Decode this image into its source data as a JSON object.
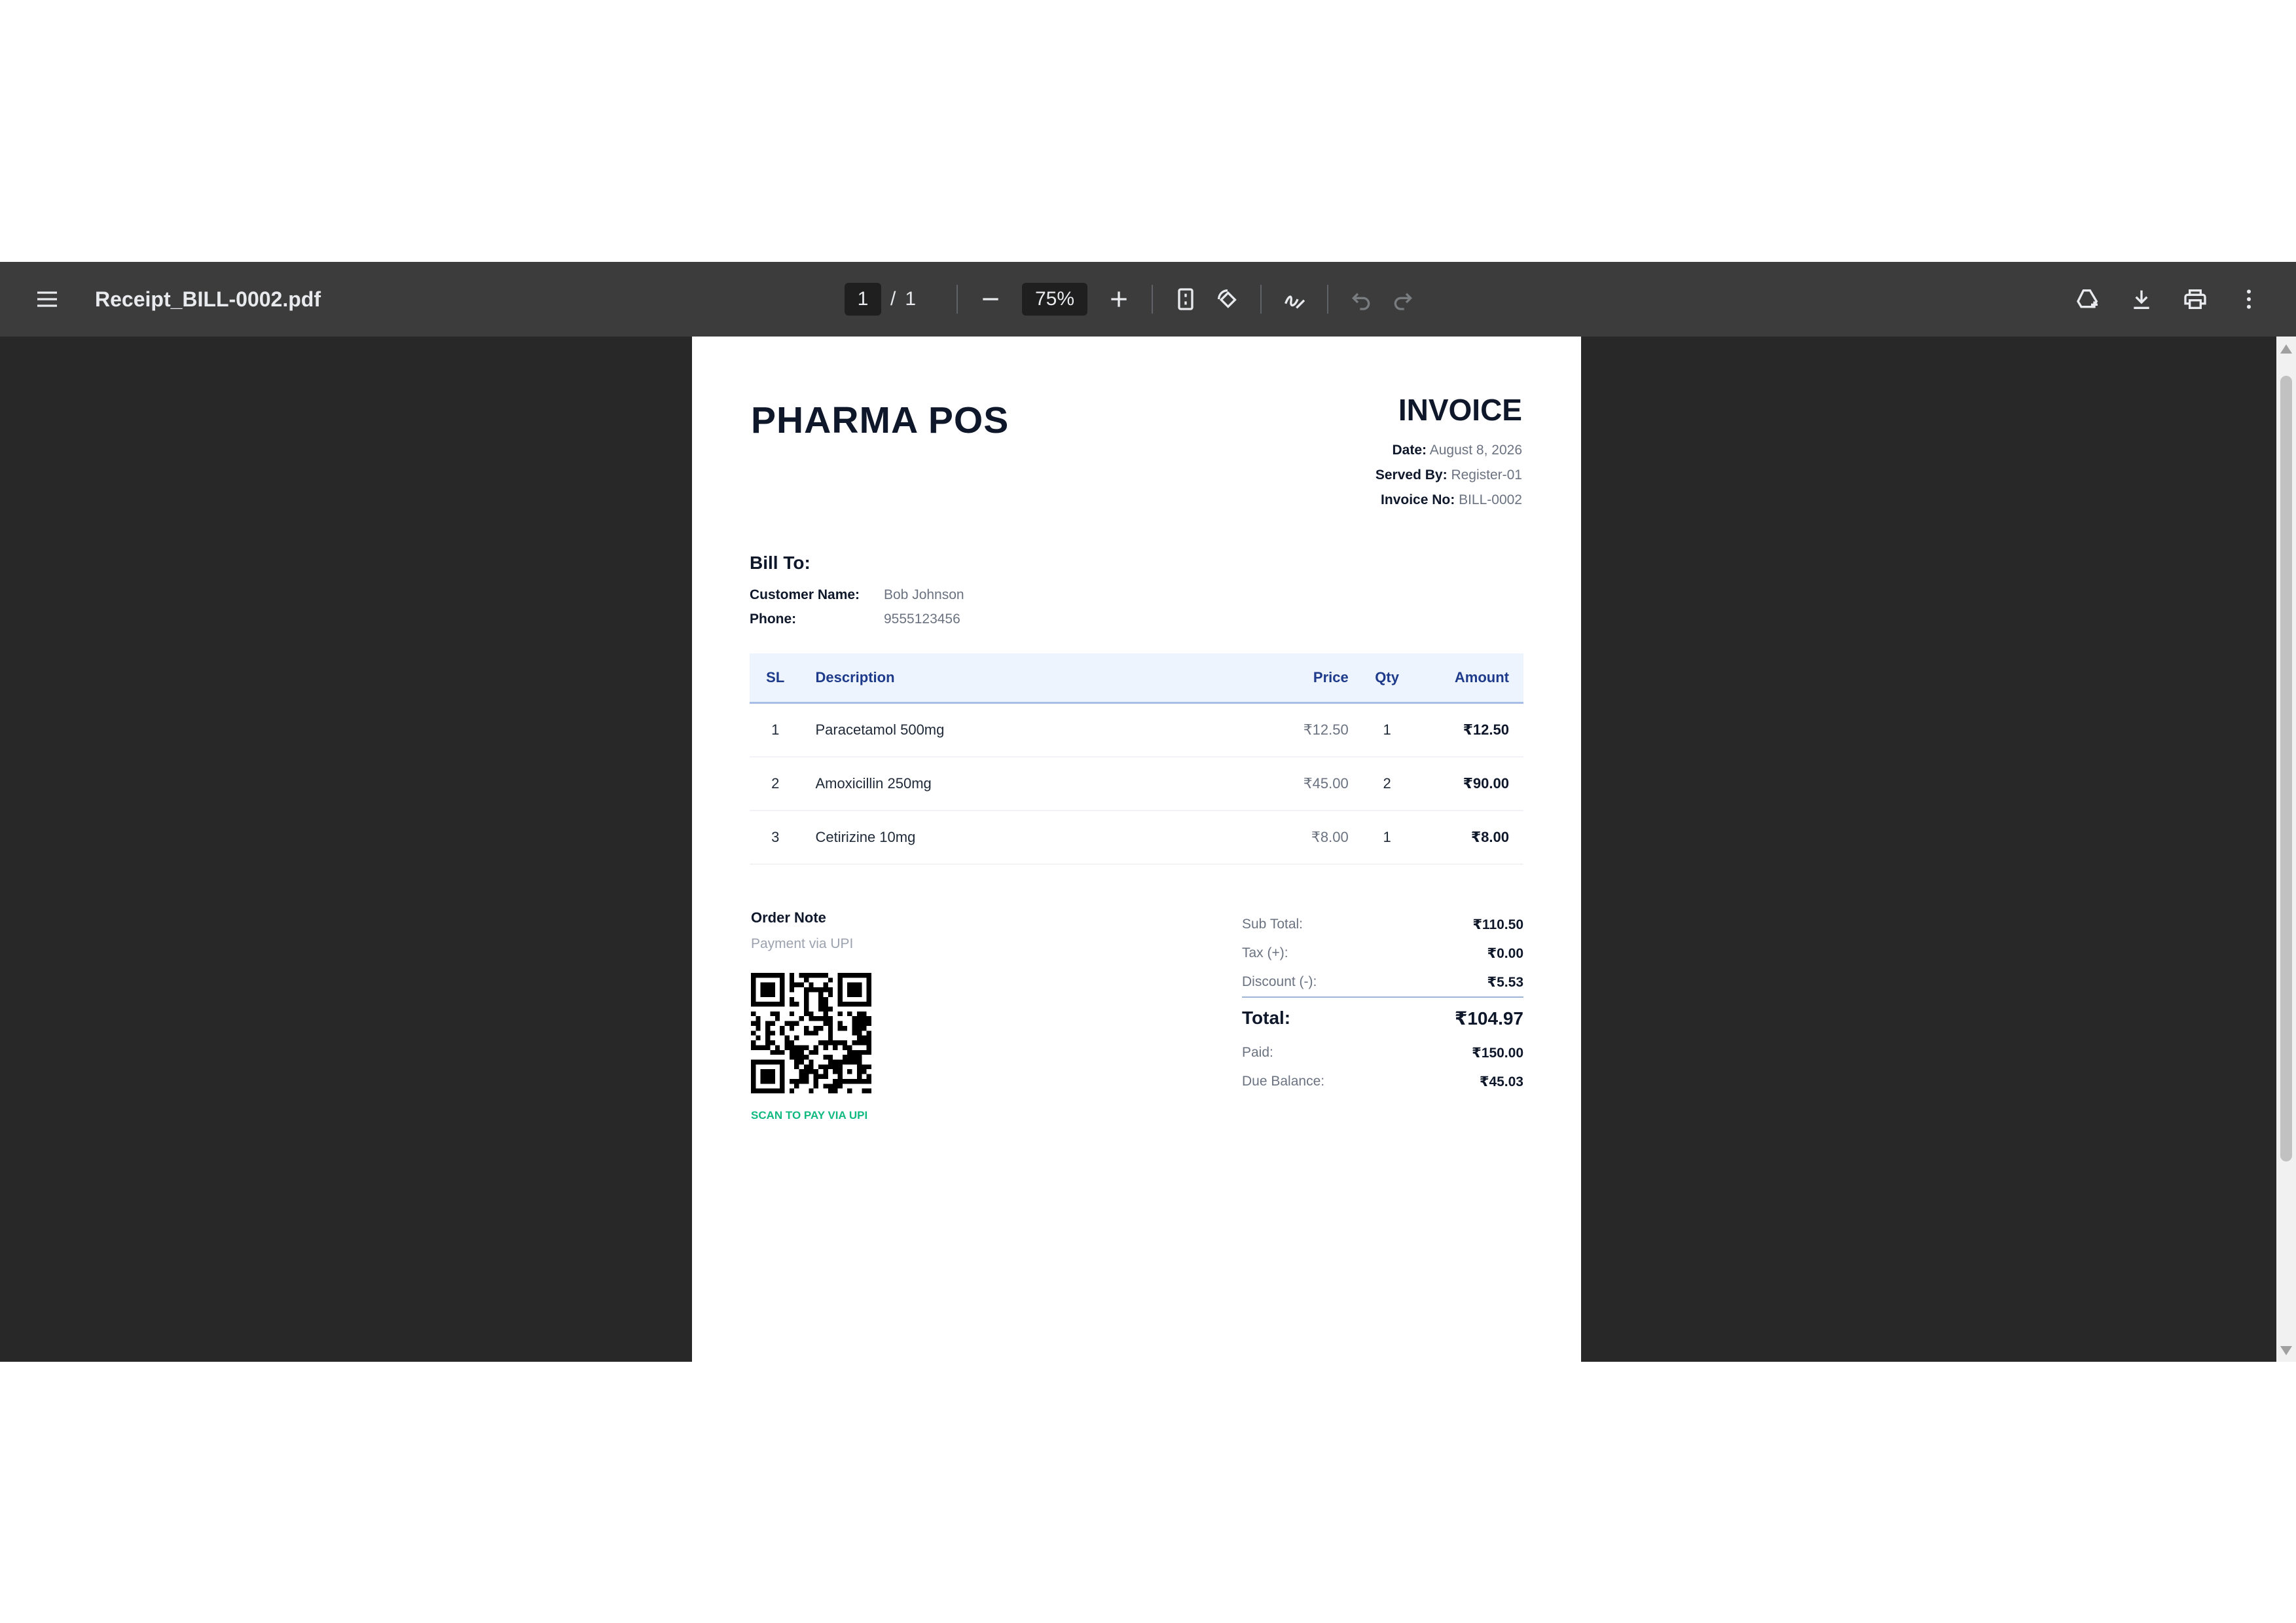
{
  "viewer": {
    "file_name": "Receipt_BILL-0002.pdf",
    "current_page": "1",
    "page_separator": "/",
    "total_pages": "1",
    "zoom": "75%",
    "icons": [
      "menu-icon",
      "zoom-out-icon",
      "zoom-in-icon",
      "fit-page-icon",
      "rotate-icon",
      "draw-icon",
      "undo-icon",
      "redo-icon",
      "save-to-drive-icon",
      "download-icon",
      "print-icon",
      "more-vert-icon"
    ]
  },
  "invoice": {
    "brand": "PHARMA POS",
    "title": "INVOICE",
    "meta": [
      {
        "label": "Date:",
        "value": "August 8, 2026"
      },
      {
        "label": "Served By:",
        "value": "Register-01"
      },
      {
        "label": "Invoice No:",
        "value": "BILL-0002"
      }
    ],
    "bill_to_title": "Bill To:",
    "customer": [
      {
        "label": "Customer Name:",
        "value": "Bob Johnson"
      },
      {
        "label": "Phone:",
        "value": "9555123456"
      }
    ],
    "table": {
      "headers": {
        "sl": "SL",
        "description": "Description",
        "price": "Price",
        "qty": "Qty",
        "amount": "Amount"
      },
      "rows": [
        {
          "sl": "1",
          "description": "Paracetamol 500mg",
          "price": "₹12.50",
          "qty": "1",
          "amount": "₹12.50"
        },
        {
          "sl": "2",
          "description": "Amoxicillin 250mg",
          "price": "₹45.00",
          "qty": "2",
          "amount": "₹90.00"
        },
        {
          "sl": "3",
          "description": "Cetirizine 10mg",
          "price": "₹8.00",
          "qty": "1",
          "amount": "₹8.00"
        }
      ]
    },
    "order_note_title": "Order Note",
    "order_note_text": "Payment via UPI",
    "scan_label": "SCAN TO PAY VIA UPI",
    "totals": {
      "sub_total": {
        "label": "Sub Total:",
        "value": "₹110.50"
      },
      "tax": {
        "label": "Tax (+):",
        "value": "₹0.00"
      },
      "discount": {
        "label": "Discount (-):",
        "value": "₹5.53"
      },
      "total": {
        "label": "Total:",
        "value": "₹104.97"
      },
      "paid": {
        "label": "Paid:",
        "value": "₹150.00"
      },
      "due": {
        "label": "Due Balance:",
        "value": "₹45.03"
      }
    }
  },
  "colors": {
    "toolbar_bg": "#3c3c3c",
    "viewer_bg": "#282828",
    "table_header_bg": "#eef4fd",
    "table_header_text": "#1e3a8a",
    "scan_text": "#10b981"
  }
}
